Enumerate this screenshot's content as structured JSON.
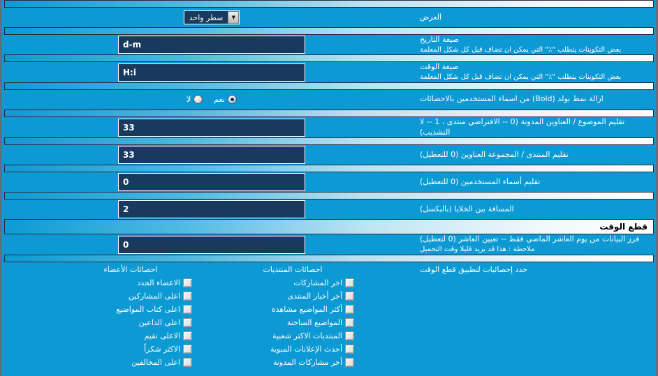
{
  "colors": {
    "background": "#0d9ad4",
    "input_fill": "#173a5e",
    "text": "#ffffff",
    "border": "#6b6b80"
  },
  "rows": [
    {
      "label": "العرض",
      "sub": "",
      "control": "select",
      "value": "سطر واحد"
    },
    {
      "label": "صيغة التاريخ",
      "sub": "بعض التكوينات يتطلب \"٪\" التي يمكن ان تضاف قبل كل شكل المعلمة",
      "control": "text",
      "value": "d-m"
    },
    {
      "label": "صيغة الوقت",
      "sub": "بعض التكوينات يتطلب \"٪\" التي يمكن ان تضاف قبل كل شكل المعلمة",
      "control": "text",
      "value": "H:i"
    },
    {
      "label": "ازالة نمط بولد (Bold) من اسماء المستخدمين بالاحصائات",
      "sub": "",
      "control": "radio",
      "value": "نعم"
    },
    {
      "label": "تقليم الموضوع / العناوين المدونة (0 -- الافتراضي منتدى ، 1 -- لا التشذيب)",
      "sub": "",
      "control": "text",
      "value": "33"
    },
    {
      "label": "تقليم المنتدى / المجموعة العناوين (0 للتعطيل)",
      "sub": "",
      "control": "text",
      "value": "33"
    },
    {
      "label": "تقليم أسماء المستخدمين (0 للتعطيل)",
      "sub": "",
      "control": "text",
      "value": "0"
    },
    {
      "label": "المسافة بين الخلايا (بالبكسل)",
      "sub": "",
      "control": "text",
      "value": "2"
    }
  ],
  "section": {
    "title": "قطع الوقت"
  },
  "timecut_row": {
    "label": "فرز البيانات من يوم العاشر الماضي فقط -- تعيين العاشر (0 لتعطيل)",
    "sub": "ملاحظة : هذا قد يزيد قليلا وقت التحميل",
    "value": "0"
  },
  "radio_options": {
    "yes": "نعم",
    "no": "لا"
  },
  "checkbox_section": {
    "label": "حدد إحصائيات لتطبيق قطع الوقت",
    "columns": [
      {
        "title": "احصائات المنتديات",
        "items": [
          {
            "label": "اخر المشاركات",
            "checked": false
          },
          {
            "label": "آخر أخبار المنتدى",
            "checked": false
          },
          {
            "label": "أكثر المواضيع مشاهدة",
            "checked": false
          },
          {
            "label": "المواضيع الساخنة",
            "checked": false
          },
          {
            "label": "المنتديات الاكثر شعبية",
            "checked": false
          },
          {
            "label": "أحدث الإعلانات المبوبة",
            "checked": false
          },
          {
            "label": "أخر مشاركات المدونة",
            "checked": false
          }
        ]
      },
      {
        "title": "احصائات الأعضاء",
        "items": [
          {
            "label": "الاعضاء الجدد",
            "checked": false
          },
          {
            "label": "اعلى المشاركين",
            "checked": false
          },
          {
            "label": "اعلى كتاب المواضيع",
            "checked": false
          },
          {
            "label": "اعلى الداعين",
            "checked": false
          },
          {
            "label": "الاعلى تقيم",
            "checked": false
          },
          {
            "label": "الاكثر شكراً",
            "checked": false
          },
          {
            "label": "اعلى المخالفين",
            "checked": false
          }
        ]
      }
    ]
  },
  "icons": {
    "dropdown_arrow": "▼"
  }
}
